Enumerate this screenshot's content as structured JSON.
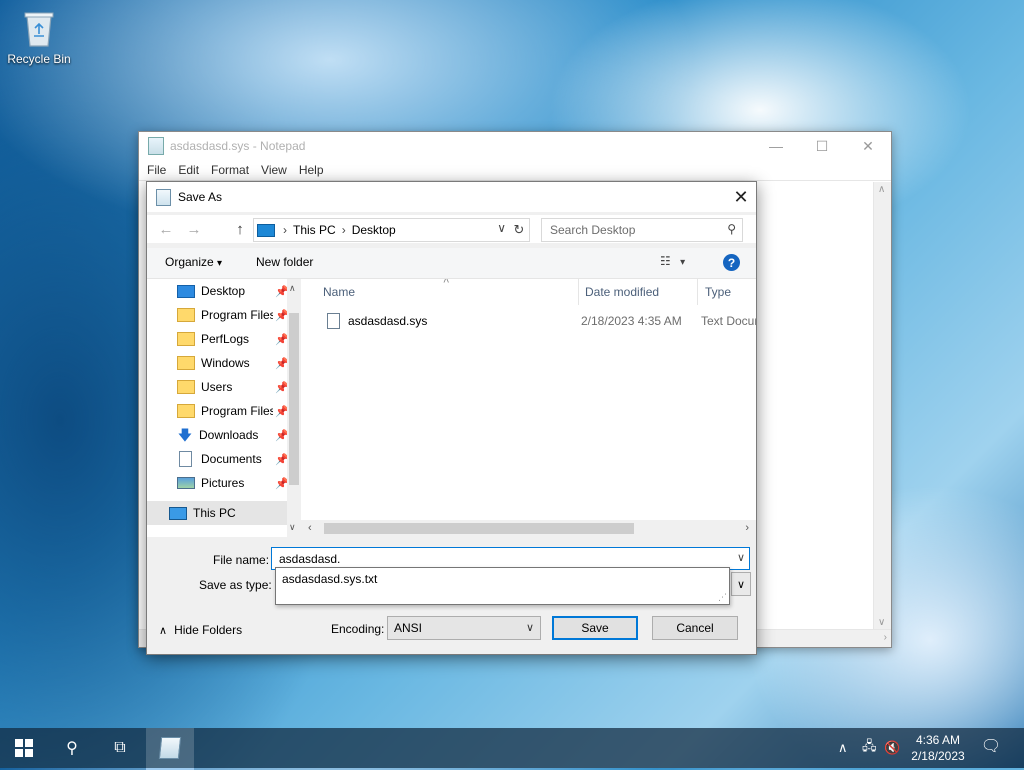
{
  "desktop": {
    "recycle_bin_label": "Recycle Bin"
  },
  "notepad": {
    "title": "asdasdasd.sys - Notepad",
    "menu": [
      "File",
      "Edit",
      "Format",
      "View",
      "Help"
    ]
  },
  "dialog": {
    "title": "Save As",
    "address": {
      "crumbs": [
        "This PC",
        "Desktop"
      ]
    },
    "search_placeholder": "Search Desktop",
    "toolbar": {
      "organize": "Organize",
      "new_folder": "New folder"
    },
    "nav_items": [
      {
        "label": "Desktop",
        "icon": "desktop-icon",
        "pinned": true
      },
      {
        "label": "Program Files",
        "icon": "folder-icon",
        "pinned": true
      },
      {
        "label": "PerfLogs",
        "icon": "folder-icon",
        "pinned": true
      },
      {
        "label": "Windows",
        "icon": "folder-icon",
        "pinned": true
      },
      {
        "label": "Users",
        "icon": "folder-icon",
        "pinned": true
      },
      {
        "label": "Program Files",
        "icon": "folder-icon",
        "pinned": true
      },
      {
        "label": "Downloads",
        "icon": "download-icon",
        "pinned": true
      },
      {
        "label": "Documents",
        "icon": "document-icon",
        "pinned": true
      },
      {
        "label": "Pictures",
        "icon": "pictures-icon",
        "pinned": true
      },
      {
        "label": "This PC",
        "icon": "computer-icon",
        "pinned": false,
        "selected": true
      }
    ],
    "columns": {
      "name": "Name",
      "date": "Date modified",
      "type": "Type"
    },
    "files": [
      {
        "name": "asdasdasd.sys",
        "date": "2/18/2023 4:35 AM",
        "type": "Text Document"
      }
    ],
    "file_name_label": "File name:",
    "file_name_value": "asdasdasd.",
    "save_type_label": "Save as type:",
    "autocomplete": [
      "asdasdasd.sys.txt"
    ],
    "hide_folders": "Hide Folders",
    "encoding_label": "Encoding:",
    "encoding_value": "ANSI",
    "save_label": "Save",
    "cancel_label": "Cancel"
  },
  "taskbar": {
    "time": "4:36 AM",
    "date": "2/18/2023"
  }
}
